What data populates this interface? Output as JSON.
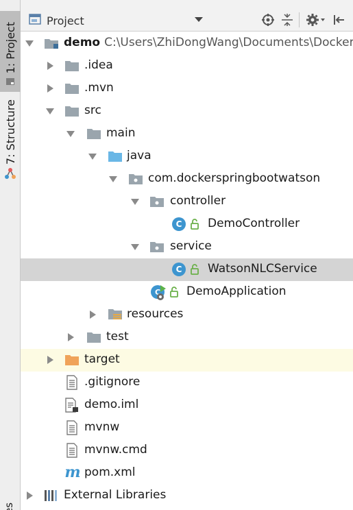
{
  "stripe": {
    "project_tab": "1: Project",
    "structure_tab": "7: Structure",
    "bottom_partial": "es"
  },
  "header": {
    "view_label": "Project"
  },
  "tree": {
    "root": {
      "name": "demo",
      "path": "C:\\Users\\ZhiDongWang\\Documents\\Docker\\d"
    },
    "idea": ".idea",
    "mvn": ".mvn",
    "src": "src",
    "main": "main",
    "java": "java",
    "package": "com.dockerspringbootwatson",
    "controller": "controller",
    "demo_controller": "DemoController",
    "service": "service",
    "watson_service": "WatsonNLCService",
    "demo_application": "DemoApplication",
    "resources": "resources",
    "test": "test",
    "target": "target",
    "gitignore": ".gitignore",
    "demo_iml": "demo.iml",
    "mvnw": "mvnw",
    "mvnw_cmd": "mvnw.cmd",
    "pom": "pom.xml",
    "external_libraries": "External Libraries"
  },
  "colors": {
    "selection": "#d4d4d4",
    "excluded_row": "#fdfbe3",
    "class_badge": "#3d95cf",
    "target_folder": "#f0a35a",
    "source_folder": "#6ab7e6",
    "folder": "#9aa5ad"
  },
  "icons": {
    "root": "module-folder-icon",
    "folder": "folder-icon",
    "source_folder": "source-folder-icon",
    "package": "package-icon",
    "class": "class-icon",
    "spring_boot_app": "spring-boot-app-icon",
    "resources": "resources-folder-icon",
    "excluded_folder": "excluded-folder-icon",
    "text_file": "text-file-icon",
    "iml_file": "iml-file-icon",
    "maven": "maven-icon",
    "libraries": "libraries-icon",
    "locate": "locate-icon",
    "collapse": "collapse-all-icon",
    "settings": "gear-icon",
    "hide": "hide-panel-icon"
  }
}
